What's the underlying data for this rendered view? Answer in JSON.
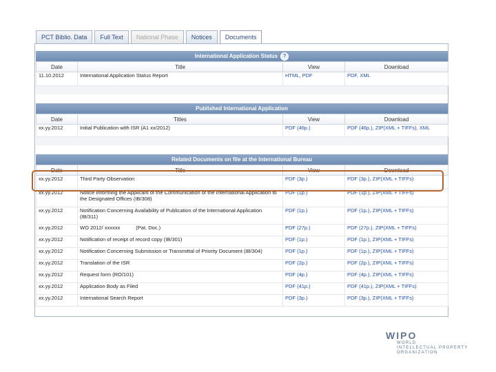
{
  "tabs": [
    {
      "label": "PCT Biblio. Data",
      "state": "normal"
    },
    {
      "label": "Full Text",
      "state": "normal"
    },
    {
      "label": "National Phase",
      "state": "disabled"
    },
    {
      "label": "Notices",
      "state": "normal"
    },
    {
      "label": "Documents",
      "state": "active"
    }
  ],
  "status_section": {
    "title": "International Application Status",
    "info_icon": "info-icon",
    "headers": [
      "Date",
      "Title",
      "View",
      "Download"
    ],
    "rows": [
      {
        "date": "11.10.2012",
        "title": "International Application Status Report",
        "view": "HTML, PDF",
        "download": "PDF, XML"
      }
    ]
  },
  "published_section": {
    "title": "Published International Application",
    "headers": [
      "Date",
      "Titles",
      "View",
      "Download"
    ],
    "rows": [
      {
        "date": "xx.yy.2012",
        "title": "Initial Publication with ISR (A1 xx/2012)",
        "view": "PDF (46p.)",
        "download": "PDF (46p.), ZIP(XML + TIFFs), XML"
      }
    ]
  },
  "related_section": {
    "title": "Related Documents on file at the International Bureau",
    "headers": [
      "Date",
      "Title",
      "View",
      "Download"
    ],
    "rows": [
      {
        "date": "xx.yy.2012",
        "title": "Third Party Observation",
        "view": "PDF (3p.)",
        "download": "PDF (3p.), ZIP(XML + TIFFs)"
      },
      {
        "date": "xx.yy.2012",
        "title": "Notice Informing the Applicant of the Communication of the International Application to the Designated Offices (IB/308)",
        "view": "PDF (1p.)",
        "download": "PDF (1p.), ZIP(XML + TIFFs)"
      },
      {
        "date": "xx.yy.2012",
        "title": "Notification Concerning Availability of Publication of the International Application (IB/311)",
        "view": "PDF (1p.)",
        "download": "PDF (1p.), ZIP(XML + TIFFs)"
      },
      {
        "date": "xx.yy.2012",
        "title": "WO 2012/ xxxxxx           (Pat. Doc.)",
        "view": "PDF (27p.)",
        "download": "PDF (27p.), ZIP(XML + TIFFs)"
      },
      {
        "date": "xx.yy.2012",
        "title": "Notification of receipt of record copy (IB/301)",
        "view": "PDF (1p.)",
        "download": "PDF (1p.), ZIP(XML + TIFFs)"
      },
      {
        "date": "xx.yy.2012",
        "title": "Notification Concerning Submission or Transmittal of Priority Document (IB/304)",
        "view": "PDF (1p.)",
        "download": "PDF (1p.), ZIP(XML + TIFFs)"
      },
      {
        "date": "xx.yy.2012",
        "title": "Translation of the ISR",
        "view": "PDF (2p.)",
        "download": "PDF (2p.), ZIP(XML + TIFFs)"
      },
      {
        "date": "xx.yy.2012",
        "title": "Request form (RO/101)",
        "view": "PDF (4p.)",
        "download": "PDF (4p.), ZIP(XML + TIFFs)"
      },
      {
        "date": "xx.yy.2012",
        "title": "Application Body as Filed",
        "view": "PDF (41p.)",
        "download": "PDF (41p.), ZIP(XML + TIFFs)"
      },
      {
        "date": "xx.yy.2012",
        "title": "International Search Report",
        "view": "PDF (3p.)",
        "download": "PDF (3p.), ZIP(XML + TIFFs)"
      }
    ]
  },
  "logo": {
    "mark": "WIPO",
    "line1": "WORLD",
    "line2": "INTELLECTUAL PROPERTY",
    "line3": "ORGANIZATION"
  },
  "colors": {
    "header_bar": "#7a95bb",
    "link": "#1f4ea8",
    "highlight_border": "#b8602b"
  }
}
